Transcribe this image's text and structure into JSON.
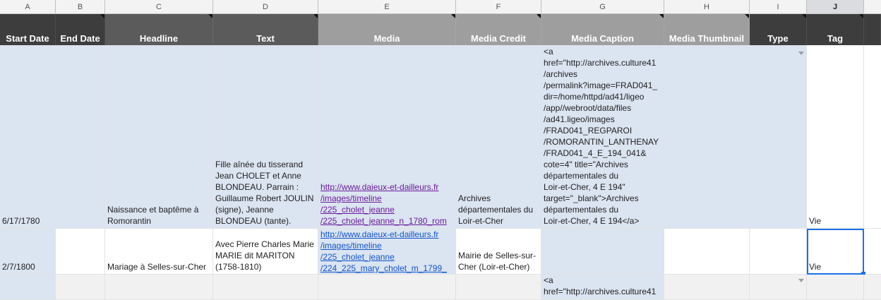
{
  "columns": [
    {
      "letter": "A",
      "title": "Start Date"
    },
    {
      "letter": "B",
      "title": "End Date"
    },
    {
      "letter": "C",
      "title": "Headline"
    },
    {
      "letter": "D",
      "title": "Text"
    },
    {
      "letter": "E",
      "title": "Media"
    },
    {
      "letter": "F",
      "title": "Media Credit"
    },
    {
      "letter": "G",
      "title": "Media Caption"
    },
    {
      "letter": "H",
      "title": "Media Thumbnail"
    },
    {
      "letter": "I",
      "title": "Type"
    },
    {
      "letter": "J",
      "title": "Tag"
    }
  ],
  "selected_column": "J",
  "rows": [
    {
      "start_date": "6/17/1780",
      "end_date": "",
      "headline": "Naissance et baptême à Romorantin",
      "text": "Fille aînée du tisserand Jean CHOLET et Anne BLONDEAU. Parrain : Guillaume Robert JOULIN (signe), Jeanne BLONDEAU (tante).",
      "media": "http://www.daieux-et-dailleurs.fr\n/images/timeline\n/225_cholet_jeanne\n/225_cholet_jeanne_n_1780_rom",
      "media_credit": "Archives départementales du Loir-et-Cher",
      "media_caption": "<a\nhref=\"http://archives.culture41\n/archives\n/permalink?image=FRAD041_\ndir=/home/httpd/ad41/ligeo\n/app//webroot/data/files\n/ad41.ligeo/images\n/FRAD041_REGPAROI\n/ROMORANTIN_LANTHENAY\n/FRAD041_4_E_194_041&\ncote=4\" title=\"Archives\ndépartementales du\nLoir-et-Cher, 4 E 194\"\ntarget=\"_blank\">Archives\ndépartementales du\nLoir-et-Cher, 4 E 194</a>",
      "media_thumbnail": "",
      "type": "",
      "tag": "Vie"
    },
    {
      "start_date": "2/7/1800",
      "end_date": "",
      "headline": "Mariage à Selles-sur-Cher",
      "text": "Avec Pierre Charles Marie MARIE dit MARITON (1758-1810)",
      "media": "http://www.daieux-et-dailleurs.fr\n/images/timeline\n/225_cholet_jeanne\n/224_225_mary_cholet_m_1799_",
      "media_credit": "Mairie de Selles-sur-Cher (Loir-et-Cher)",
      "media_caption": "",
      "media_thumbnail": "",
      "type": "",
      "tag": "Vie"
    },
    {
      "start_date": "",
      "end_date": "",
      "headline": "",
      "text": "",
      "media": "",
      "media_credit": "",
      "media_caption": "<a\nhref=\"http://archives.culture41",
      "media_thumbnail": "",
      "type": "",
      "tag": ""
    }
  ],
  "colors": {
    "header_dark": "#3d3d3d",
    "header_mid": "#5b5b5b",
    "header_light": "#9e9e9e",
    "row_blue": "#dbe4f1",
    "link": "#1155cc",
    "link_visited": "#6a1b9a",
    "selection": "#1a73e8"
  }
}
